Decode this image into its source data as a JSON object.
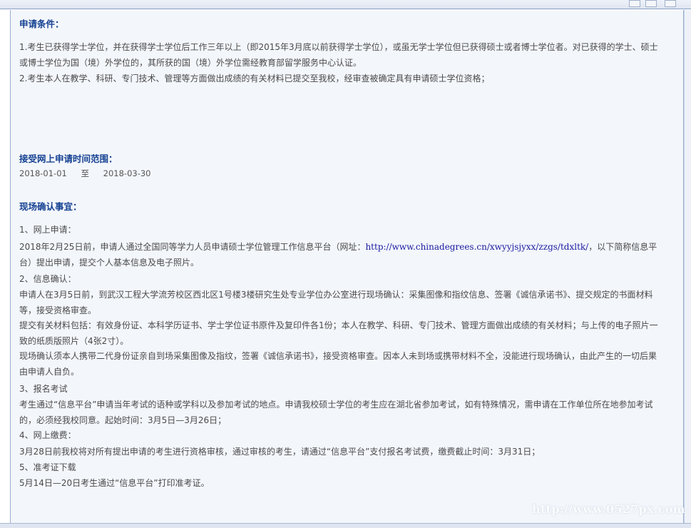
{
  "sections": {
    "conditions": {
      "heading": "申请条件：",
      "items": [
        "1.考生已获得学士学位，并在获得学士学位后工作三年以上（即2015年3月底以前获得学士学位），或虽无学士学位但已获得硕士或者博士学位者。对已获得的学士、硕士或博士学位为国（境）外学位的，其所获的国（境）外学位需经教育部留学服务中心认证。",
        "2.考生本人在教学、科研、专门技术、管理等方面做出成绩的有关材料已提交至我校，经审查被确定具有申请硕士学位资格；"
      ]
    },
    "online_period": {
      "heading": "接受网上申请时间范围：",
      "start": "2018-01-01",
      "to": "至",
      "end": "2018-03-30"
    },
    "onsite": {
      "heading": "现场确认事宜：",
      "step1_title": "1、网上申请：",
      "step1_text_a": "2018年2月25日前，申请人通过全国同等学力人员申请硕士学位管理工作信息平台（网址：",
      "step1_link": "http://www.chinadegrees.cn/xwyyjsjyxx/zzgs/tdxltk/",
      "step1_text_b": "，以下简称信息平台）提出申请，提交个人基本信息及电子照片。",
      "step2_title": "2、信息确认：",
      "step2_text_1": "申请人在3月5日前，到武汉工程大学流芳校区西北区1号楼3楼研究生处专业学位办公室进行现场确认：采集图像和指纹信息、签署《诚信承诺书》、提交规定的书面材料等，接受资格审查。",
      "step2_text_2": "提交有关材料包括：有效身份证、本科学历证书、学士学位证书原件及复印件各1份；本人在教学、科研、专门技术、管理方面做出成绩的有关材料；与上传的电子照片一致的纸质版照片（4张2寸）。",
      "step2_text_3": "现场确认须本人携带二代身份证亲自到场采集图像及指纹，签署《诚信承诺书》，接受资格审查。因本人未到场或携带材料不全，没能进行现场确认，由此产生的一切后果由申请人自负。",
      "step3_title": "3、报名考试",
      "step3_text": "考生通过“信息平台”申请当年考试的语种或学科以及参加考试的地点。申请我校硕士学位的考生应在湖北省参加考试，如有特殊情况，需申请在工作单位所在地参加考试的，必须经我校同意。起始时间：3月5日—3月26日；",
      "step4_title": "4、网上缴费：",
      "step4_text": "3月28日前我校将对所有提出申请的考生进行资格审核，通过审核的考生，请通过“信息平台”支付报名考试费，缴费截止时间：3月31日；",
      "step5_title": "5、准考证下载",
      "step5_text": "5月14日—20日考生通过“信息平台”打印准考证。"
    }
  },
  "watermark": "http://www.0527px.com"
}
